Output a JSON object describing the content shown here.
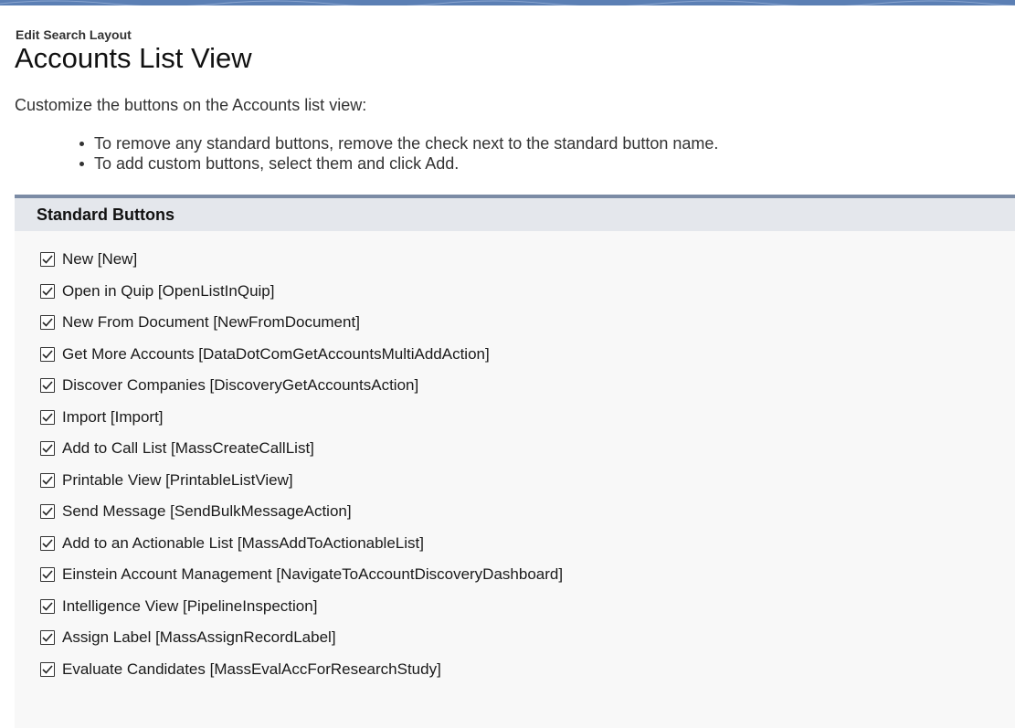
{
  "header": {
    "eyebrow": "Edit Search Layout",
    "title": "Accounts List View"
  },
  "intro": "Customize the buttons on the Accounts list view:",
  "instructions": [
    "To remove any standard buttons, remove the check next to the standard button name.",
    "To add custom buttons, select them and click Add."
  ],
  "standard_buttons": {
    "title": "Standard Buttons",
    "items": [
      {
        "label": "New [New]",
        "checked": true
      },
      {
        "label": "Open in Quip [OpenListInQuip]",
        "checked": true
      },
      {
        "label": "New From Document [NewFromDocument]",
        "checked": true
      },
      {
        "label": "Get More Accounts [DataDotComGetAccountsMultiAddAction]",
        "checked": true
      },
      {
        "label": "Discover Companies [DiscoveryGetAccountsAction]",
        "checked": true
      },
      {
        "label": "Import [Import]",
        "checked": true
      },
      {
        "label": "Add to Call List [MassCreateCallList]",
        "checked": true
      },
      {
        "label": "Printable View [PrintableListView]",
        "checked": true
      },
      {
        "label": "Send Message [SendBulkMessageAction]",
        "checked": true
      },
      {
        "label": "Add to an Actionable List [MassAddToActionableList]",
        "checked": true
      },
      {
        "label": "Einstein Account Management [NavigateToAccountDiscoveryDashboard]",
        "checked": true
      },
      {
        "label": "Intelligence View [PipelineInspection]",
        "checked": true
      },
      {
        "label": "Assign Label [MassAssignRecordLabel]",
        "checked": true
      },
      {
        "label": "Evaluate Candidates [MassEvalAccForResearchStudy]",
        "checked": true
      }
    ]
  },
  "colors": {
    "banner": "#5b7fb4",
    "section_border": "#7b8ba5",
    "section_header_bg": "#e4e7ec",
    "section_bg": "#f8f8f8"
  }
}
